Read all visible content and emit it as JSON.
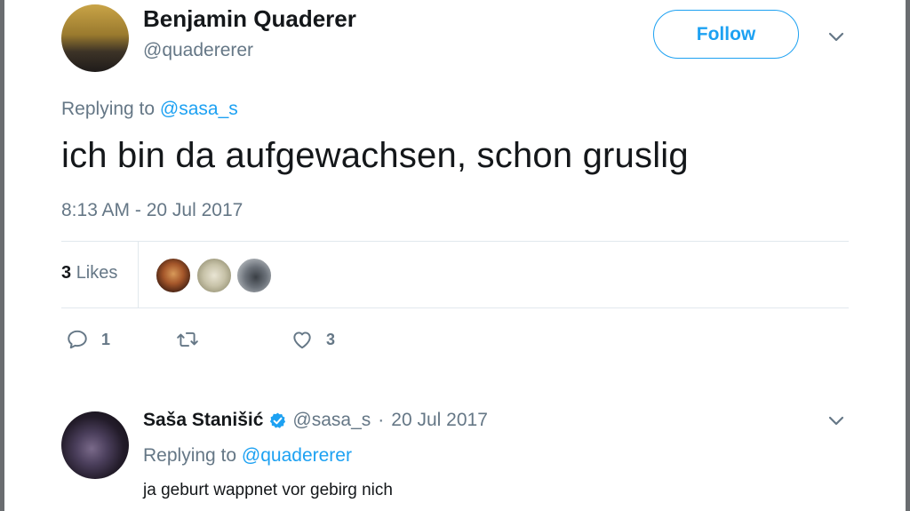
{
  "tweet": {
    "author_name": "Benjamin Quaderer",
    "author_handle": "@quadererer",
    "follow_label": "Follow",
    "replying_prefix": "Replying to ",
    "replying_to": "@sasa_s",
    "text": "ich bin da aufgewachsen, schon gruslig",
    "timestamp": "8:13 AM - 20 Jul 2017",
    "likes_count": "3",
    "likes_label": "Likes",
    "actions": {
      "reply_count": "1",
      "like_count": "3"
    }
  },
  "reply": {
    "author_name": "Saša Stanišić",
    "author_handle": "@sasa_s",
    "separator": "·",
    "date": "20 Jul 2017",
    "replying_prefix": "Replying to ",
    "replying_to": "@quadererer",
    "text": "ja geburt wappnet vor gebirg nich"
  },
  "icons": {
    "more": "chevron-down-icon",
    "reply": "reply-icon",
    "retweet": "retweet-icon",
    "like": "heart-icon",
    "verified": "verified-badge-icon"
  },
  "colors": {
    "accent": "#1da1f2",
    "secondary_text": "#657786",
    "primary_text": "#14171a",
    "divider": "#e1e8ed"
  }
}
